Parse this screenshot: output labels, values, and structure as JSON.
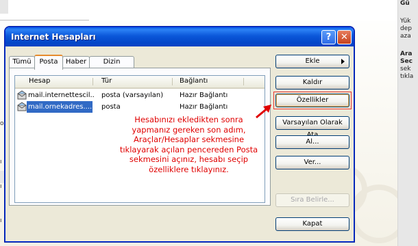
{
  "background": {
    "right_col": [
      "Gü",
      "Yük",
      "dep",
      "aza",
      "Ara",
      "Sec",
      "sek",
      "tıkla"
    ],
    "left_marks": [
      "o",
      "ı",
      "ı",
      "ı"
    ]
  },
  "dialog": {
    "title": "Internet Hesapları",
    "help_label": "?",
    "close_label": "✕",
    "tabs": [
      "Tümü",
      "Posta",
      "Haber",
      "Dizin Hizmeti"
    ],
    "active_tab": "Posta",
    "columns": [
      "Hesap",
      "Tür",
      "Bağlantı"
    ],
    "rows": [
      {
        "account": "mail.internettescil...",
        "type": "posta (varsayılan)",
        "connection": "Hazır Bağlantı",
        "selected": false
      },
      {
        "account": "mail.ornekadres....",
        "type": "posta",
        "connection": "Hazır Bağlantı",
        "selected": true
      }
    ],
    "buttons": {
      "add": "Ekle",
      "remove": "Kaldır",
      "properties": "Özellikler",
      "set_default": "Varsayılan Olarak Ata",
      "import": "Al...",
      "export": "Ver...",
      "set_order": "Sıra Belirle...",
      "close": "Kapat"
    },
    "annotation": "Hesabınızı ekledikten sonra yapmanız gereken son adım, Araçlar/Hesaplar sekmesine tıklayarak açılan pencereden Posta sekmesini açınız, hesabı seçip özelliklere tıklayınız."
  },
  "colors": {
    "titlebar": "#0b57d9",
    "selection": "#316ac5",
    "annotation": "#e00000",
    "highlight": "#e8332f"
  }
}
